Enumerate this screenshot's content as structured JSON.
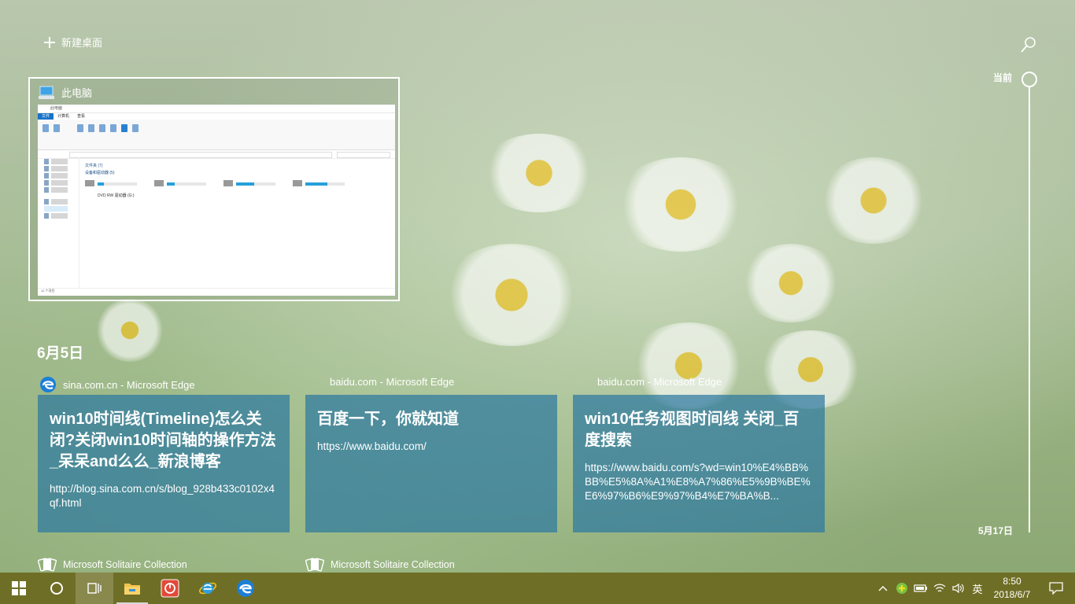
{
  "header": {
    "new_desktop_label": "新建桌面"
  },
  "window_thumbnail": {
    "title": "此电脑",
    "preview": {
      "title_bar": "此电脑",
      "tabs": [
        "文件",
        "计算机",
        "查看"
      ],
      "nav_items": [
        "快速访问",
        "桌面",
        "下载",
        "文档",
        "图片",
        "OneDrive",
        "此电脑",
        "网络"
      ],
      "groups": [
        "文件夹 (7)",
        "设备和驱动器 (5)"
      ],
      "drives": [
        {
          "name": "win10 (C:)",
          "used": 0.15
        },
        {
          "name": "机械硬盘 (D:)",
          "used": 0.2
        },
        {
          "name": "本地磁盘 (E:)",
          "used": 0.45
        },
        {
          "name": "工具盘 (F:)",
          "used": 0.55
        }
      ],
      "dvd": "DVD RW 驱动器 (G:)",
      "status": "12 个项目"
    }
  },
  "timeline": {
    "date_label": "6月5日",
    "activities": [
      {
        "source": "sina.com.cn - Microsoft Edge",
        "title": "win10时间线(Timeline)怎么关闭?关闭win10时间轴的操作方法_呆呆and么么_新浪博客",
        "url": "http://blog.sina.com.cn/s/blog_928b433c0102x4qf.html"
      },
      {
        "source": "baidu.com - Microsoft Edge",
        "title": "百度一下，你就知道",
        "url": "https://www.baidu.com/"
      },
      {
        "source": "baidu.com - Microsoft Edge",
        "title": "win10任务视图时间线 关闭_百度搜索",
        "url": "https://www.baidu.com/s?wd=win10%E4%BB%BB%E5%8A%A1%E8%A7%86%E5%9B%BE%E6%97%B6%E9%97%B4%E7%BA%B..."
      }
    ],
    "apps": [
      {
        "name": "Microsoft Solitaire Collection"
      },
      {
        "name": "Microsoft Solitaire Collection"
      }
    ]
  },
  "scrubber": {
    "current_label": "当前",
    "bottom_date": "5月17日"
  },
  "taskbar": {
    "ime_label": "英",
    "time": "8:50",
    "date": "2018/6/7",
    "colors": {
      "taskbar": "#6f6e26",
      "card": "#2d78a0"
    }
  }
}
